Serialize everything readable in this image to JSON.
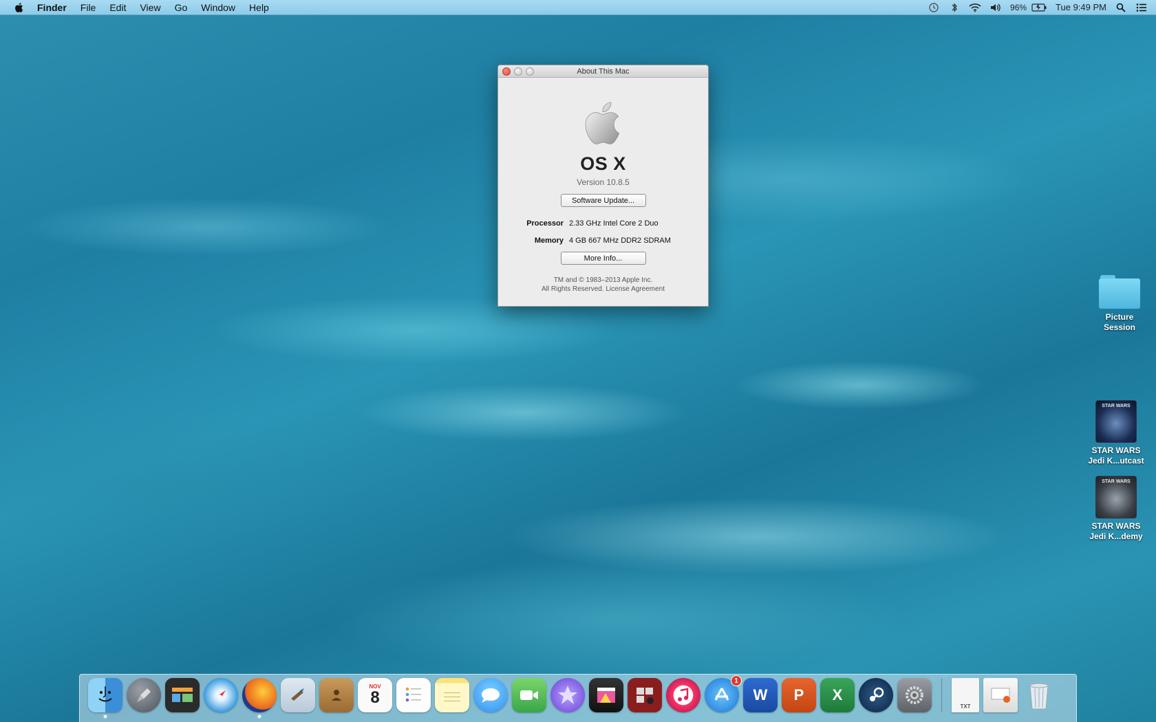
{
  "menubar": {
    "items": [
      "Finder",
      "File",
      "Edit",
      "View",
      "Go",
      "Window",
      "Help"
    ],
    "battery": "96%",
    "clock": "Tue 9:49 PM"
  },
  "about_window": {
    "title": "About This Mac",
    "os_name": "OS X",
    "version": "Version 10.8.5",
    "software_update_label": "Software Update...",
    "processor_label": "Processor",
    "processor_value": "2.33 GHz Intel Core 2 Duo",
    "memory_label": "Memory",
    "memory_value": "4 GB 667 MHz DDR2 SDRAM",
    "more_info_label": "More Info...",
    "legal_line1": "TM and © 1983–2013 Apple Inc.",
    "legal_line2": "All Rights Reserved.",
    "license_link": "License Agreement"
  },
  "desktop": {
    "icons": [
      {
        "line1": "Picture",
        "line2": "Session"
      },
      {
        "line1": "STAR WARS",
        "line2": "Jedi K...utcast"
      },
      {
        "line1": "STAR WARS",
        "line2": "Jedi K...demy"
      }
    ]
  },
  "dock": {
    "items": [
      "finder",
      "launchpad",
      "mission-control",
      "safari",
      "firefox",
      "mail",
      "contacts",
      "calendar",
      "reminders",
      "notes",
      "messages",
      "facetime",
      "imovie",
      "final-cut",
      "photo-booth",
      "itunes",
      "app-store",
      "word",
      "powerpoint",
      "excel",
      "steam",
      "system-preferences"
    ],
    "calendar_month": "NOV",
    "calendar_day": "8",
    "app_store_badge": "1",
    "stack_label": "TXT"
  },
  "colors": {
    "menubar": "#9fd5ef",
    "close_button": "#e0443a",
    "folder": "#5fc6ea"
  }
}
